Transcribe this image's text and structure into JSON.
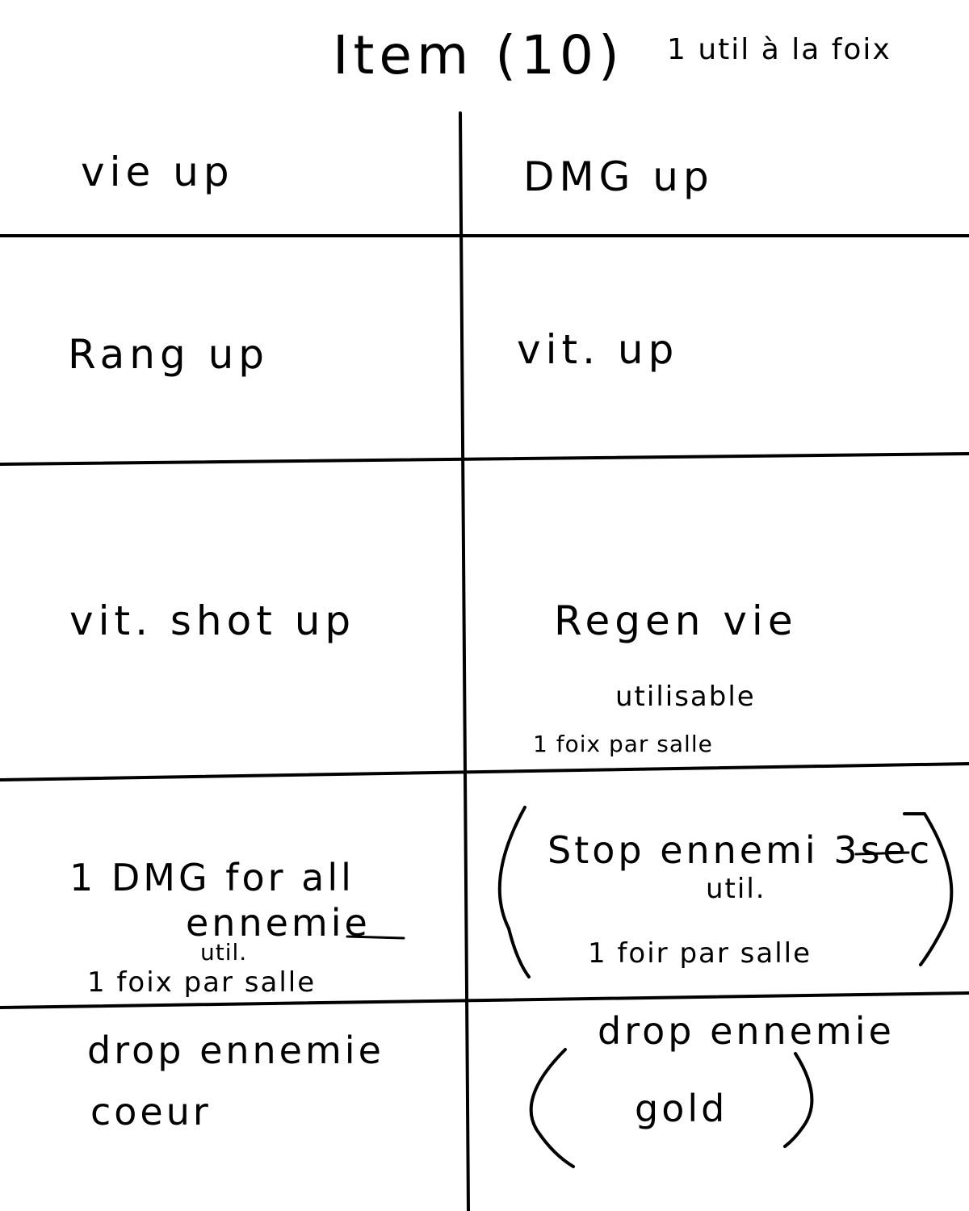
{
  "header": {
    "title": "Item (10)",
    "note": "1 util à la foix"
  },
  "grid": {
    "rows": [
      {
        "left": {
          "label": "vie up"
        },
        "right": {
          "label": "DMG up"
        }
      },
      {
        "left": {
          "label": "Rang up"
        },
        "right": {
          "label": "vit. up"
        }
      },
      {
        "left": {
          "label": "vit. shot up"
        },
        "right": {
          "label": "Regen vie",
          "note": "utilisable",
          "note2": "1 foix par salle"
        }
      },
      {
        "left": {
          "label": "1 DMG for all",
          "label2": "ennemie",
          "note": "util.",
          "note2": "1 foix par salle"
        },
        "right": {
          "label": "Stop ennemi 3sec",
          "note": "util.",
          "note2": "1 foir par salle"
        }
      },
      {
        "left": {
          "label": "drop ennemie",
          "label2": "coeur"
        },
        "right": {
          "label": "drop ennemie",
          "label2": "gold"
        }
      }
    ]
  }
}
